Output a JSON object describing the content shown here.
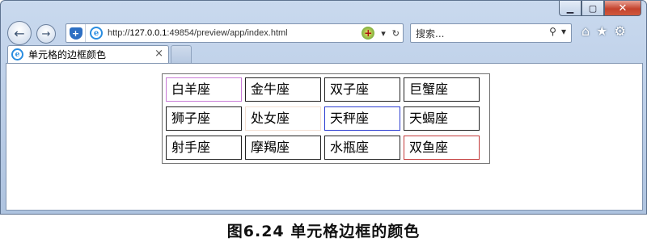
{
  "window": {
    "minimize_icon": "minimize-icon",
    "maximize_icon": "maximize-icon",
    "close_icon": "close-icon"
  },
  "nav": {
    "back_icon": "arrow-left-icon",
    "forward_icon": "arrow-right-icon",
    "url_prefix": "http://",
    "url_host": "127.0.0.1",
    "url_rest": ":49854/preview/app/index.html",
    "search_placeholder": "搜索...",
    "icons": [
      "home-icon",
      "star-icon",
      "gear-icon"
    ]
  },
  "tab": {
    "title": "单元格的边框颜色",
    "close": "×"
  },
  "table": {
    "rows": [
      [
        {
          "text": "白羊座",
          "border": "#c87ad6"
        },
        {
          "text": "金牛座",
          "border": "#222222"
        },
        {
          "text": "双子座",
          "border": "#222222"
        },
        {
          "text": "巨蟹座",
          "border": "#222222"
        }
      ],
      [
        {
          "text": "狮子座",
          "border": "#222222"
        },
        {
          "text": "处女座",
          "border": "#f3dfd2"
        },
        {
          "text": "天秤座",
          "border": "#2a3bd0"
        },
        {
          "text": "天蝎座",
          "border": "#222222"
        }
      ],
      [
        {
          "text": "射手座",
          "border": "#222222"
        },
        {
          "text": "摩羯座",
          "border": "#222222"
        },
        {
          "text": "水瓶座",
          "border": "#222222"
        },
        {
          "text": "双鱼座",
          "border": "#c23a3a"
        }
      ]
    ]
  },
  "caption": "图6.24  单元格边框的颜色"
}
